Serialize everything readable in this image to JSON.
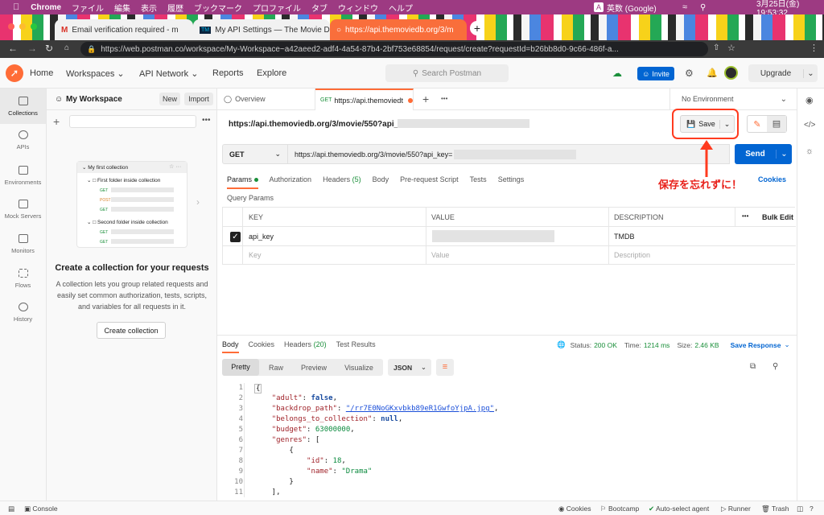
{
  "mac": {
    "apple_icon": "apple-icon",
    "app": "Chrome",
    "menus": [
      "ファイル",
      "編集",
      "表示",
      "履歴",
      "ブックマーク",
      "プロファイル",
      "タブ",
      "ウィンドウ",
      "ヘルプ"
    ],
    "ime": "英数 (Google)",
    "datetime": "3月25日(金)  19:53:32"
  },
  "browser": {
    "tabs": [
      {
        "label": "Email verification required - m"
      },
      {
        "label": "My API Settings — The Movie D"
      },
      {
        "label": "https://api.themoviedb.org/3/m"
      }
    ],
    "url": "https://web.postman.co/workspace/My-Workspace~a42aeed2-adf4-4a54-87b4-2bf753e68854/request/create?requestId=b26bb8d0-9c66-486f-a..."
  },
  "header": {
    "nav": [
      "Home",
      "Workspaces",
      "API Network",
      "Reports",
      "Explore"
    ],
    "search_placeholder": "Search Postman",
    "invite": "Invite",
    "upgrade": "Upgrade"
  },
  "sidebar": {
    "workspace": "My Workspace",
    "new": "New",
    "import": "Import",
    "items": [
      {
        "label": "Collections",
        "icon": "collections-icon"
      },
      {
        "label": "APIs",
        "icon": "apis-icon"
      },
      {
        "label": "Environments",
        "icon": "environments-icon"
      },
      {
        "label": "Mock Servers",
        "icon": "mock-servers-icon"
      },
      {
        "label": "Monitors",
        "icon": "monitors-icon"
      },
      {
        "label": "Flows",
        "icon": "flows-icon"
      },
      {
        "label": "History",
        "icon": "history-icon"
      }
    ],
    "illustration": {
      "collection": "My first collection",
      "folder1": "First folder inside collection",
      "folder2": "Second folder inside collection",
      "method_get": "GET",
      "method_post": "POST"
    },
    "empty_title": "Create a collection for your requests",
    "empty_desc": "A collection lets you group related requests and easily set common authorization, tests, scripts, and variables for all requests in it.",
    "create_button": "Create collection"
  },
  "main": {
    "tabs": [
      {
        "label": "Overview"
      },
      {
        "method": "GET",
        "label": "https://api.themoviedt"
      }
    ],
    "environment": "No Environment",
    "request_title": "https://api.themoviedb.org/3/movie/550?api_key=",
    "save": "Save",
    "method": "GET",
    "url": "https://api.themoviedb.org/3/movie/550?api_key=",
    "send": "Send",
    "annotation": "保存を忘れずに！",
    "req_tabs": [
      "Params",
      "Authorization",
      "Headers",
      "Body",
      "Pre-request Script",
      "Tests",
      "Settings"
    ],
    "headers_count": "(5)",
    "cookies": "Cookies",
    "query_params": "Query Params",
    "columns": [
      "KEY",
      "VALUE",
      "DESCRIPTION"
    ],
    "bulk_edit": "Bulk Edit",
    "rows": [
      {
        "key": "api_key",
        "value": "",
        "description": "TMDB"
      }
    ],
    "placeholders": {
      "key": "Key",
      "value": "Value",
      "description": "Description"
    }
  },
  "response": {
    "tabs": [
      "Body",
      "Cookies",
      "Headers",
      "Test Results"
    ],
    "headers_count": "(20)",
    "status_label": "Status:",
    "status": "200 OK",
    "time_label": "Time:",
    "time": "1214 ms",
    "size_label": "Size:",
    "size": "2.46 KB",
    "save_response": "Save Response",
    "views": [
      "Pretty",
      "Raw",
      "Preview",
      "Visualize"
    ],
    "format": "JSON",
    "lines": [
      "1",
      "2",
      "3",
      "4",
      "5",
      "6",
      "7",
      "8",
      "9",
      "10",
      "11"
    ]
  },
  "json": {
    "adult_key": "\"adult\"",
    "adult_val": "false",
    "backdrop_key": "\"backdrop_path\"",
    "backdrop_val": "\"/rr7E0NoGKxvbkb89eR1GwfoYjpA.jpg\"",
    "belongs_key": "\"belongs_to_collection\"",
    "belongs_val": "null",
    "budget_key": "\"budget\"",
    "budget_val": "63000000",
    "genres_key": "\"genres\"",
    "id_key": "\"id\"",
    "id_val": "18",
    "name_key": "\"name\"",
    "name_val": "\"Drama\""
  },
  "status_bar": {
    "console": "Console",
    "cookies": "Cookies",
    "bootcamp": "Bootcamp",
    "auto_select": "Auto-select agent",
    "runner": "Runner",
    "trash": "Trash"
  },
  "colors": {
    "accent": "#0265d2",
    "brand": "#ff6c37",
    "highlight": "#ff3b1f"
  }
}
